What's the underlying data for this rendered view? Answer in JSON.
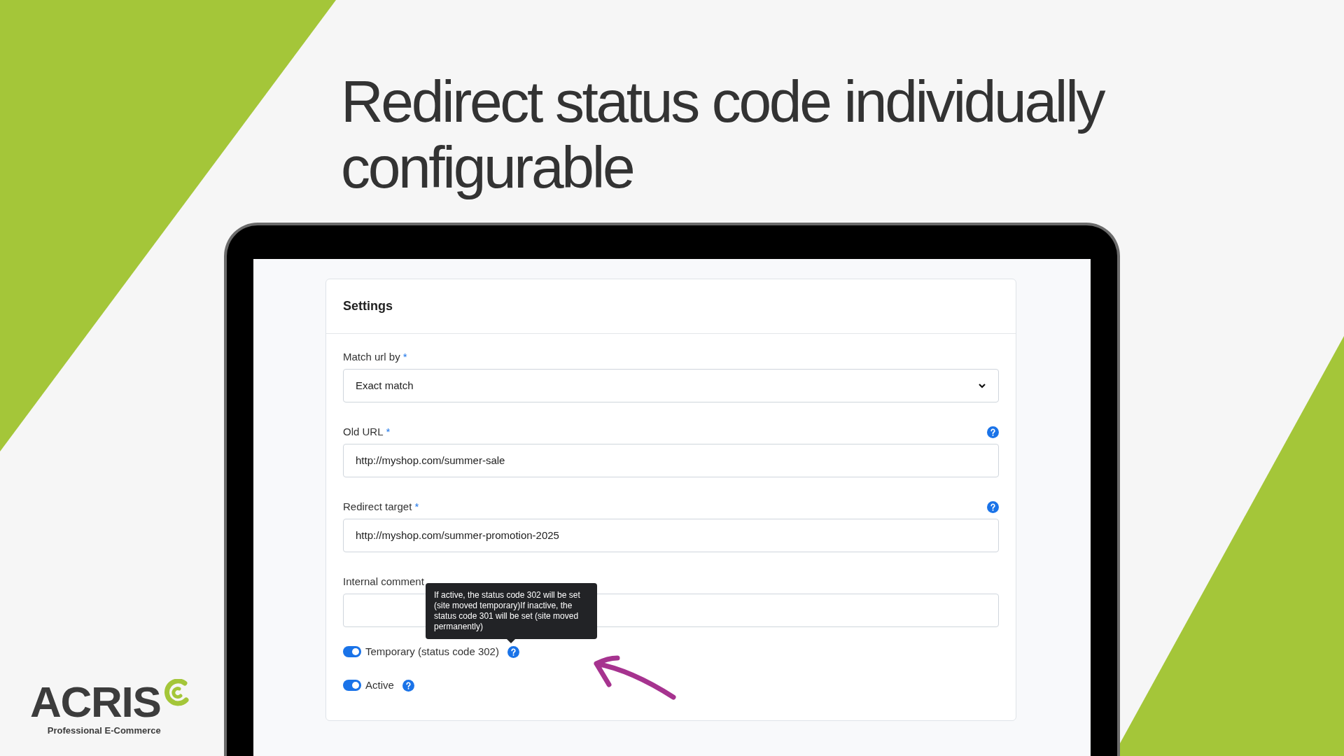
{
  "headline": "Redirect status code individually configurable",
  "card": {
    "title": "Settings",
    "fields": [
      {
        "kind": "select",
        "label": "Match url by",
        "required_mark": "*",
        "help": false,
        "value": "Exact match"
      },
      {
        "kind": "text",
        "label": "Old URL",
        "required_mark": "*",
        "help": true,
        "value": "http://myshop.com/summer-sale"
      },
      {
        "kind": "text",
        "label": "Redirect target",
        "required_mark": "*",
        "help": true,
        "value": "http://myshop.com/summer-promotion-2025"
      },
      {
        "kind": "text",
        "label": "Internal comment",
        "help": false
      }
    ],
    "toggles": [
      {
        "label": "Temporary (status code 302)",
        "on": true,
        "tooltip": "If active, the status code 302 will be set (site moved temporary)If inactive, the status code 301 will be set (site moved permanently)"
      },
      {
        "label": "Active",
        "on": true
      }
    ]
  },
  "logo": {
    "name": "ACRIS",
    "tagline": "Professional E-Commerce"
  }
}
